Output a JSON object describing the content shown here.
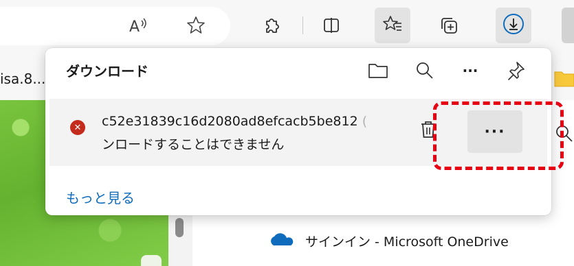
{
  "toolbar": {
    "icons": [
      "read-aloud-icon",
      "favorite-star-icon",
      "extensions-icon",
      "split-screen-icon",
      "favorites-icon",
      "collections-icon",
      "downloads-icon"
    ],
    "accent": "#0f6cbd"
  },
  "bookmarks": {
    "item_text": "isa.8..."
  },
  "download_panel": {
    "title": "ダウンロード",
    "item": {
      "filename": "c52e31839c16d2080ad8efcacb5be812",
      "filename_overflow": "(",
      "status": "ンロードすることはできません",
      "more_label": "···"
    },
    "see_more": "もっと見る"
  },
  "page": {
    "onedrive_label": "サインイン - Microsoft OneDrive"
  },
  "annotation": {
    "color": "#e60012"
  }
}
